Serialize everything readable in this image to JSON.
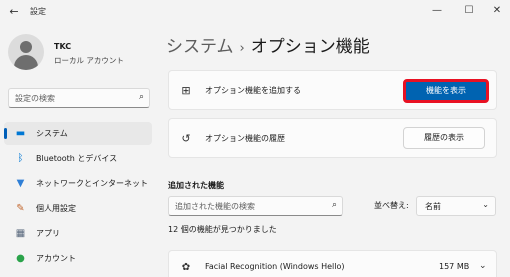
{
  "window": {
    "title": "設定",
    "back_icon": "back-arrow-icon",
    "minimize_glyph": "—",
    "maximize_glyph": "☐",
    "close_glyph": "✕"
  },
  "profile": {
    "name": "TKC",
    "account_type": "ローカル アカウント"
  },
  "sidebar": {
    "search_placeholder": "設定の検索",
    "items": [
      {
        "label": "システム",
        "icon": "monitor-icon",
        "glyph": "▬",
        "color": "#0078d4",
        "active": true
      },
      {
        "label": "Bluetooth とデバイス",
        "icon": "bluetooth-icon",
        "glyph": "ᛒ",
        "color": "#0078d4",
        "active": false
      },
      {
        "label": "ネットワークとインターネット",
        "icon": "wifi-icon",
        "glyph": "▼",
        "color": "#2f7fd6",
        "active": false
      },
      {
        "label": "個人用設定",
        "icon": "brush-icon",
        "glyph": "✎",
        "color": "#c2662d",
        "active": false
      },
      {
        "label": "アプリ",
        "icon": "apps-icon",
        "glyph": "▦",
        "color": "#55657a",
        "active": false
      },
      {
        "label": "アカウント",
        "icon": "person-icon",
        "glyph": "●",
        "color": "#2aa34a",
        "active": false
      }
    ]
  },
  "header": {
    "breadcrumb_parent": "システム",
    "breadcrumb_sep": "›",
    "title": "オプション機能"
  },
  "cards": {
    "add": {
      "icon": "add-feature-icon",
      "glyph": "⊞",
      "label": "オプション機能を追加する",
      "button": "機能を表示"
    },
    "history": {
      "icon": "history-icon",
      "glyph": "↺",
      "label": "オプション機能の履歴",
      "button": "履歴の表示"
    }
  },
  "installed": {
    "section_title": "追加された機能",
    "search_placeholder": "追加された機能の検索",
    "sort_label": "並べ替え:",
    "sort_value": "名前",
    "count_text": "12 個の機能が見つかりました",
    "features": [
      {
        "name": "Facial Recognition (Windows Hello)",
        "size": "157 MB",
        "icon": "face-scan-icon",
        "glyph": "✿"
      }
    ]
  },
  "colors": {
    "accent": "#0063b1",
    "highlight_border": "#e81123",
    "background": "#f3f3f3"
  }
}
